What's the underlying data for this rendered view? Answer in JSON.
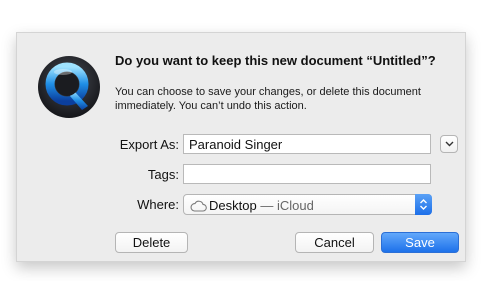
{
  "dialog": {
    "title": "Do you want to keep this new document “Untitled”?",
    "message": "You can choose to save your changes, or delete this document immediately. You can’t undo this action.",
    "app_icon": "quicktime-icon"
  },
  "form": {
    "export_label": "Export As:",
    "export_value": "Paranoid Singer",
    "tags_label": "Tags:",
    "tags_value": "",
    "where_label": "Where:",
    "where_location": "Desktop",
    "where_separator": "—",
    "where_service": "iCloud",
    "where_icon": "cloud-icon",
    "expand_icon": "chevron-down-icon",
    "popup_arrows_icon": "updown-arrows-icon"
  },
  "buttons": {
    "delete": "Delete",
    "cancel": "Cancel",
    "save": "Save"
  },
  "colors": {
    "accent": "#1d71ea",
    "dialog_bg": "#ececec"
  }
}
